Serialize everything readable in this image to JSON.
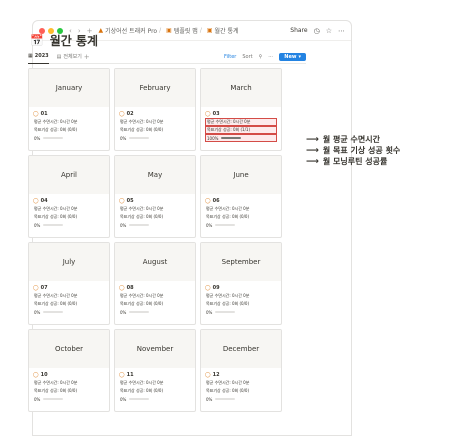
{
  "titlebar": {
    "breadcrumb_1": "기상어선 트래커 Pro",
    "breadcrumb_2": "템플릿 맵",
    "breadcrumb_3": "월간 통계",
    "share_label": "Share"
  },
  "page": {
    "title": "월간 통계"
  },
  "viewbar": {
    "tabs": [
      "2023",
      "전체보기"
    ],
    "filter_label": "Filter",
    "sort_label": "Sort",
    "new_label": "New"
  },
  "cards": [
    {
      "month": "January",
      "num": "01",
      "sleep": "평균 수면시간: 0시간 0분",
      "goal": "목표기상 성공: 0회 (0/0)",
      "progress": "0%",
      "progress_value": 0
    },
    {
      "month": "February",
      "num": "02",
      "sleep": "평균 수면시간: 0시간 0분",
      "goal": "목표기상 성공: 0회 (0/0)",
      "progress": "0%",
      "progress_value": 0
    },
    {
      "month": "March",
      "num": "03",
      "sleep": "평균 수면시간: 0시간 0분",
      "goal": "목표기상 성공: 0회 (1/1)",
      "progress": "100%",
      "progress_value": 100
    },
    {
      "month": "April",
      "num": "04",
      "sleep": "평균 수면시간: 0시간 0분",
      "goal": "목표기상 성공: 0회 (0/0)",
      "progress": "0%",
      "progress_value": 0
    },
    {
      "month": "May",
      "num": "05",
      "sleep": "평균 수면시간: 0시간 0분",
      "goal": "목표기상 성공: 0회 (0/0)",
      "progress": "0%",
      "progress_value": 0
    },
    {
      "month": "June",
      "num": "06",
      "sleep": "평균 수면시간: 0시간 0분",
      "goal": "목표기상 성공: 0회 (0/0)",
      "progress": "0%",
      "progress_value": 0
    },
    {
      "month": "July",
      "num": "07",
      "sleep": "평균 수면시간: 0시간 0분",
      "goal": "목표기상 성공: 0회 (0/0)",
      "progress": "0%",
      "progress_value": 0
    },
    {
      "month": "August",
      "num": "08",
      "sleep": "평균 수면시간: 0시간 0분",
      "goal": "목표기상 성공: 0회 (0/0)",
      "progress": "0%",
      "progress_value": 0
    },
    {
      "month": "September",
      "num": "09",
      "sleep": "평균 수면시간: 0시간 0분",
      "goal": "목표기상 성공: 0회 (0/0)",
      "progress": "0%",
      "progress_value": 0
    },
    {
      "month": "October",
      "num": "10",
      "sleep": "평균 수면시간: 0시간 0분",
      "goal": "목표기상 성공: 0회 (0/0)",
      "progress": "0%",
      "progress_value": 0
    },
    {
      "month": "November",
      "num": "11",
      "sleep": "평균 수면시간: 0시간 0분",
      "goal": "목표기상 성공: 0회 (0/0)",
      "progress": "0%",
      "progress_value": 0
    },
    {
      "month": "December",
      "num": "12",
      "sleep": "평균 수면시간: 0시간 0분",
      "goal": "목표기상 성공: 0회 (0/0)",
      "progress": "0%",
      "progress_value": 0
    }
  ],
  "annotations": [
    "월 평균 수면시간",
    "월 목표 기상 성공 횟수",
    "월 모닝루틴 성공률"
  ],
  "highlight_card_index": 2,
  "colors": {
    "accent": "#2383e2",
    "highlight": "#d44c47",
    "icon": "#d9730d"
  },
  "icons": {
    "page": "calendar-icon",
    "card": "check-circle-icon"
  }
}
